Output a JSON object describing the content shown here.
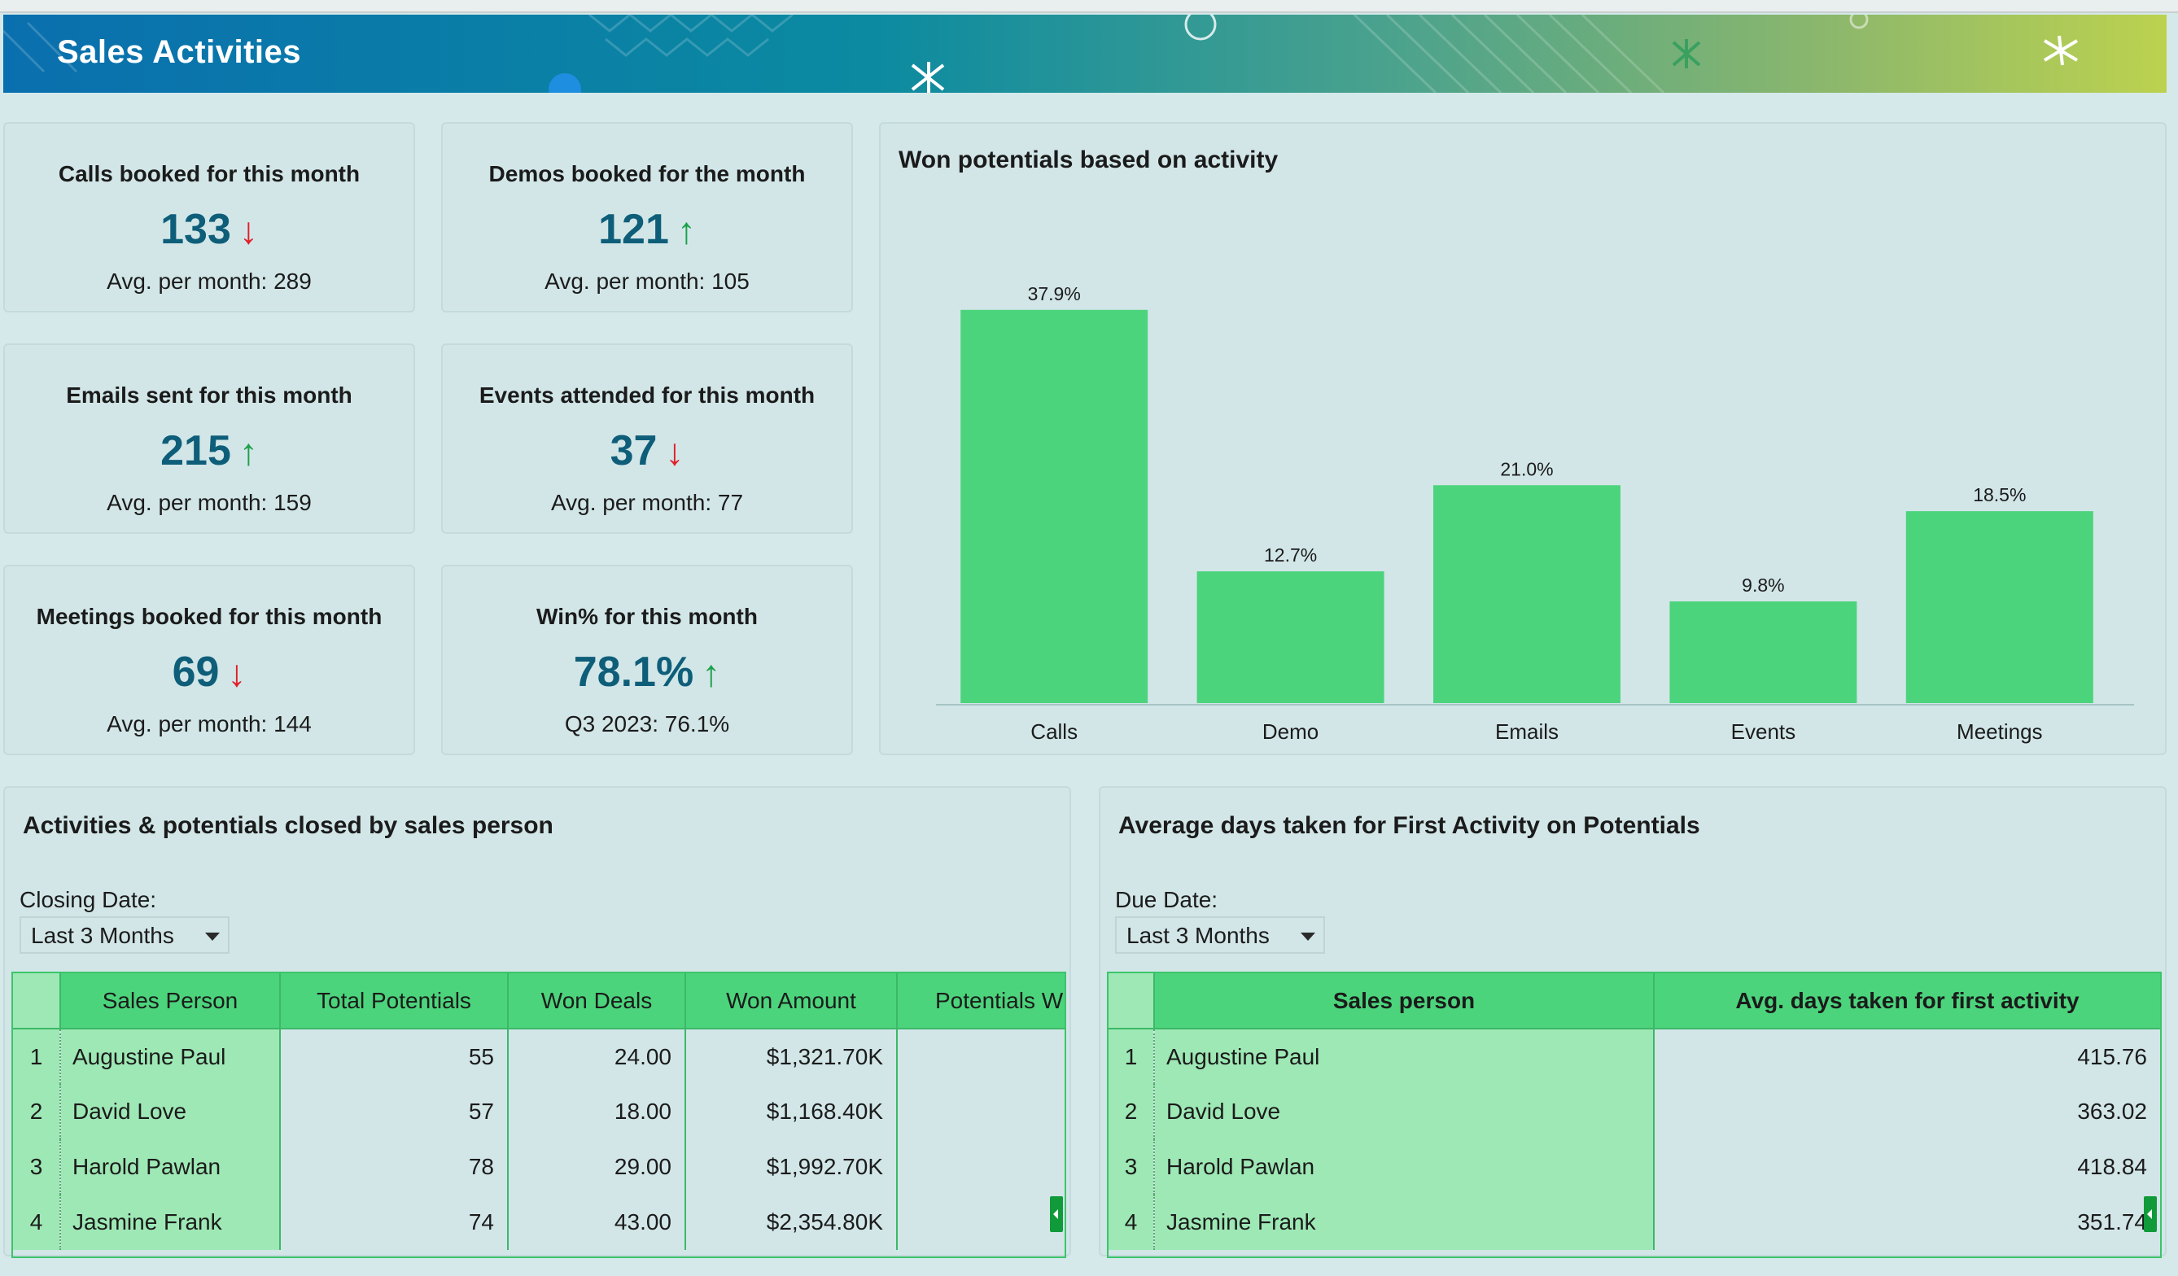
{
  "header": {
    "title": "Sales Activities"
  },
  "kpis": [
    {
      "title": "Calls booked for this month",
      "value": "133",
      "trend": "down",
      "arrow": "↓",
      "sub": "Avg. per month: 289"
    },
    {
      "title": "Demos booked for the month",
      "value": "121",
      "trend": "up",
      "arrow": "↑",
      "sub": "Avg. per month: 105"
    },
    {
      "title": "Emails sent for this month",
      "value": "215",
      "trend": "up",
      "arrow": "↑",
      "sub": "Avg. per month: 159"
    },
    {
      "title": "Events attended for this month",
      "value": "37",
      "trend": "down",
      "arrow": "↓",
      "sub": "Avg. per month: 77"
    },
    {
      "title": "Meetings booked for this month",
      "value": "69",
      "trend": "down",
      "arrow": "↓",
      "sub": "Avg. per month: 144"
    },
    {
      "title": "Win% for this month",
      "value": "78.1%",
      "trend": "up",
      "arrow": "↑",
      "sub": "Q3 2023: 76.1%"
    }
  ],
  "won_chart": {
    "title": "Won potentials based on activity"
  },
  "chart_data": {
    "type": "bar",
    "title": "Won potentials based on activity",
    "categories": [
      "Calls",
      "Demo",
      "Emails",
      "Events",
      "Meetings"
    ],
    "values": [
      37.9,
      12.7,
      21.0,
      9.8,
      18.5
    ],
    "data_labels": [
      "37.9%",
      "12.7%",
      "21.0%",
      "9.8%",
      "18.5%"
    ],
    "xlabel": "",
    "ylabel": "",
    "ylim": [
      0,
      40
    ],
    "grid": false,
    "bar_color": "#4cd47c"
  },
  "activities_table": {
    "title": "Activities & potentials closed by sales person",
    "filter_label": "Closing Date:",
    "filter_value": "Last 3 Months",
    "columns": [
      "Sales Person",
      "Total Potentials",
      "Won Deals",
      "Won Amount",
      "Potentials With"
    ],
    "rows": [
      {
        "n": "1",
        "name": "Augustine Paul",
        "total": "55",
        "won": "24.00",
        "amount": "$1,321.70K"
      },
      {
        "n": "2",
        "name": "David Love",
        "total": "57",
        "won": "18.00",
        "amount": "$1,168.40K"
      },
      {
        "n": "3",
        "name": "Harold Pawlan",
        "total": "78",
        "won": "29.00",
        "amount": "$1,992.70K"
      },
      {
        "n": "4",
        "name": "Jasmine Frank",
        "total": "74",
        "won": "43.00",
        "amount": "$2,354.80K"
      }
    ]
  },
  "days_table": {
    "title": "Average days taken for First Activity on Potentials",
    "filter_label": "Due Date:",
    "filter_value": "Last 3 Months",
    "columns": [
      "Sales person",
      "Avg. days taken for first activity"
    ],
    "rows": [
      {
        "n": "1",
        "name": "Augustine Paul",
        "days": "415.76"
      },
      {
        "n": "2",
        "name": "David Love",
        "days": "363.02"
      },
      {
        "n": "3",
        "name": "Harold Pawlan",
        "days": "418.84"
      },
      {
        "n": "4",
        "name": "Jasmine Frank",
        "days": "351.74"
      }
    ]
  },
  "colors": {
    "accent": "#0e5e79",
    "down": "#e0202a",
    "up": "#1ea04a",
    "table_header": "#4cd47c",
    "table_name_col": "#9ee8b5"
  }
}
